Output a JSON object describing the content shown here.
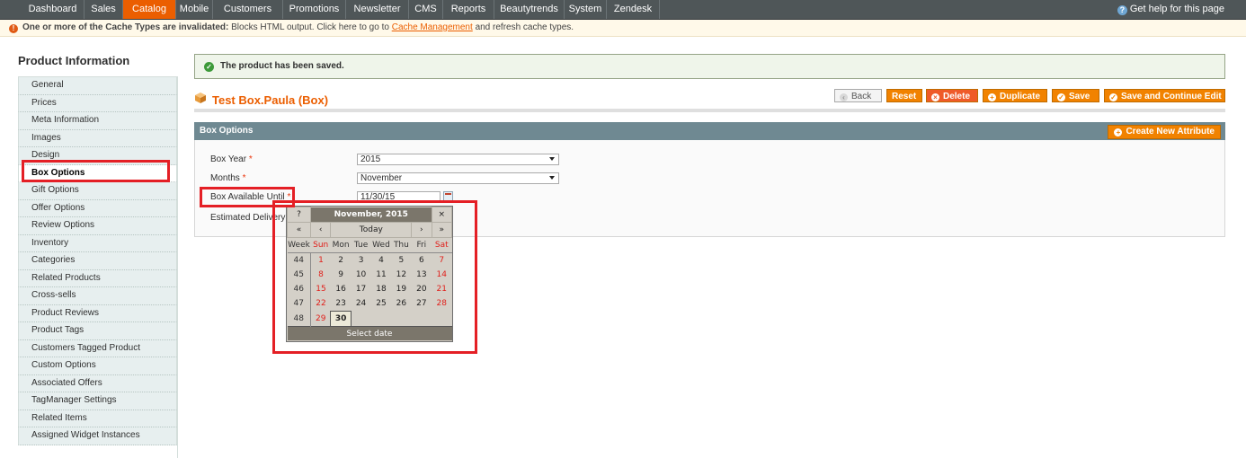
{
  "nav": {
    "items": [
      "Dashboard",
      "Sales",
      "Catalog",
      "Mobile",
      "Customers",
      "Promotions",
      "Newsletter",
      "CMS",
      "Reports",
      "Beautytrends",
      "System",
      "Zendesk"
    ],
    "active": "Catalog",
    "help": "Get help for this page"
  },
  "notice": {
    "bold": "One or more of the Cache Types are invalidated:",
    "text": "Blocks HTML output. Click here to go to",
    "link": "Cache Management",
    "tail": "and refresh cache types."
  },
  "sidebar": {
    "title": "Product Information",
    "items": [
      "General",
      "Prices",
      "Meta Information",
      "Images",
      "Design",
      "Box Options",
      "Gift Options",
      "Offer Options",
      "Review Options",
      "Inventory",
      "Categories",
      "Related Products",
      "Cross-sells",
      "Product Reviews",
      "Product Tags",
      "Customers Tagged Product",
      "Custom Options",
      "Associated Offers",
      "TagManager Settings",
      "Related Items",
      "Assigned Widget Instances"
    ],
    "active": "Box Options"
  },
  "messages": {
    "success": "The product has been saved."
  },
  "page": {
    "title": "Test Box.Paula (Box)"
  },
  "buttons": {
    "back": "Back",
    "reset": "Reset",
    "delete": "Delete",
    "duplicate": "Duplicate",
    "save": "Save",
    "save_continue": "Save and Continue Edit"
  },
  "fieldset": {
    "title": "Box Options",
    "create_attribute": "Create New Attribute",
    "fields": {
      "box_year": {
        "label": "Box Year",
        "value": "2015"
      },
      "months": {
        "label": "Months",
        "value": "November"
      },
      "box_available_until": {
        "label": "Box Available Until",
        "value": "11/30/15"
      },
      "estimated_delivery": {
        "label": "Estimated Delivery"
      }
    },
    "required_mark": "*"
  },
  "calendar": {
    "help": "?",
    "title": "November, 2015",
    "close": "×",
    "prev_year": "«",
    "prev_month": "‹",
    "today": "Today",
    "next_month": "›",
    "next_year": "»",
    "weekdays": [
      "Week",
      "Sun",
      "Mon",
      "Tue",
      "Wed",
      "Thu",
      "Fri",
      "Sat"
    ],
    "weeks": [
      {
        "week": "44",
        "days": [
          "1",
          "2",
          "3",
          "4",
          "5",
          "6",
          "7"
        ]
      },
      {
        "week": "45",
        "days": [
          "8",
          "9",
          "10",
          "11",
          "12",
          "13",
          "14"
        ]
      },
      {
        "week": "46",
        "days": [
          "15",
          "16",
          "17",
          "18",
          "19",
          "20",
          "21"
        ]
      },
      {
        "week": "47",
        "days": [
          "22",
          "23",
          "24",
          "25",
          "26",
          "27",
          "28"
        ]
      },
      {
        "week": "48",
        "days": [
          "29",
          "30",
          "",
          "",
          "",
          "",
          ""
        ]
      }
    ],
    "selected": "30",
    "footer": "Select date"
  }
}
